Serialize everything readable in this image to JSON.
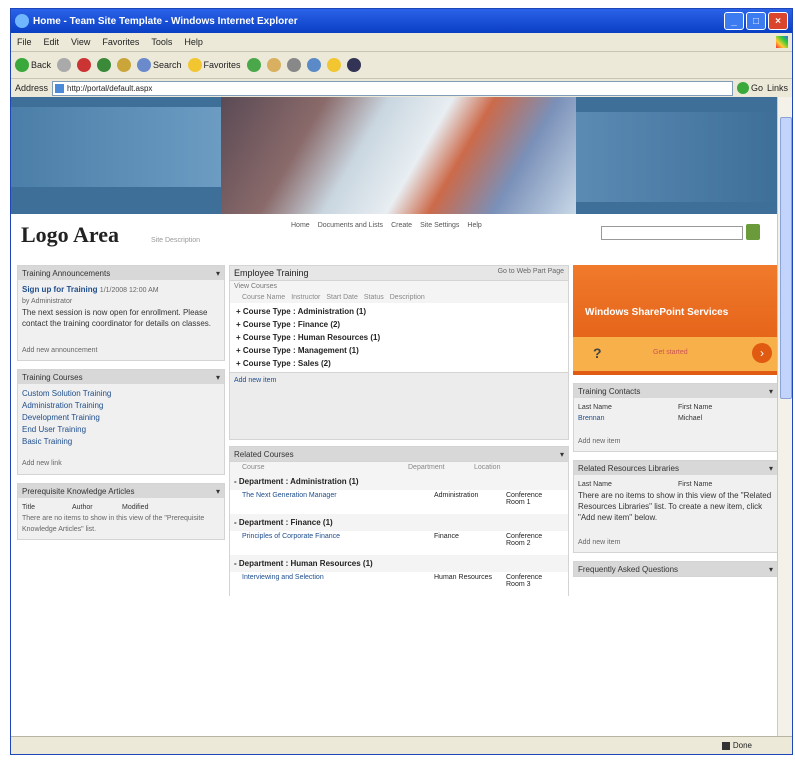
{
  "window": {
    "title": "Home - Team Site Template - Windows Internet Explorer",
    "buttons": [
      "_",
      "□",
      "×"
    ]
  },
  "menubar": [
    "File",
    "Edit",
    "View",
    "Favorites",
    "Tools",
    "Help"
  ],
  "toolbar": {
    "back_label": "Back",
    "search_label": "Search",
    "favorites_label": "Favorites"
  },
  "address": {
    "label": "Address",
    "url": "http://portal/default.aspx",
    "go_label": "Go",
    "links_label": "Links"
  },
  "site": {
    "logo": "Logo Area",
    "logo_sub": "Site Description",
    "topnav": [
      "Home",
      "Documents and Lists",
      "Create",
      "Site Settings",
      "Help"
    ]
  },
  "left": {
    "panel1": {
      "title": "Training Announcements",
      "heading": "Sign up for Training",
      "heading_suffix": "1/1/2008 12:00 AM",
      "by": "by Administrator",
      "body": "The next session is now open for enrollment. Please contact the training coordinator for details on classes.",
      "add": "Add new announcement"
    },
    "panel2": {
      "title": "Training Courses",
      "items": [
        "Custom Solution Training",
        "Administration Training",
        "Development Training",
        "End User Training",
        "Basic Training"
      ],
      "add": "Add new link"
    },
    "panel3": {
      "title": "Prerequisite Knowledge Articles",
      "cols": [
        "Title",
        "Author",
        "Modified"
      ],
      "body": "There are no items to show in this view of the \"Prerequisite Knowledge Articles\" list."
    }
  },
  "middle": {
    "header": "Employee Training",
    "header_right": "Go to Web Part Page",
    "subhead": "View Courses",
    "filters": [
      "Course Name",
      "Instructor",
      "Start Date",
      "Status",
      "Description"
    ],
    "groups": [
      "+ Course Type : Administration (1)",
      "+ Course Type : Finance (2)",
      "+ Course Type : Human Resources (1)",
      "+ Course Type : Management (1)",
      "+ Course Type : Sales (2)"
    ],
    "add": "Add new item",
    "courses": {
      "title": "Related Courses",
      "cols": [
        "Course",
        "Department",
        "Location"
      ],
      "groups": [
        {
          "label": "- Department : Administration (1)",
          "row": [
            "The Next Generation Manager",
            "Administration",
            "Conference Room 1"
          ]
        },
        {
          "label": "- Department : Finance (1)",
          "row": [
            "Principles of Corporate Finance",
            "Finance",
            "Conference Room 2"
          ]
        },
        {
          "label": "- Department : Human Resources (1)",
          "row": [
            "Interviewing and Selection",
            "Human Resources",
            "Conference Room 3"
          ]
        }
      ]
    }
  },
  "right": {
    "promo_title": "Windows SharePoint Services",
    "promo_symbol": "?",
    "promo_link": "Get started",
    "panel1": {
      "title": "Training Contacts",
      "cols": [
        "Last Name",
        "First Name"
      ],
      "rows": [
        [
          "Brennan",
          "Michael"
        ]
      ],
      "add": "Add new item"
    },
    "panel2": {
      "title": "Related Resources Libraries",
      "cols": [
        "Last Name",
        "First Name"
      ],
      "body": "There are no items to show in this view of the \"Related Resources Libraries\" list. To create a new item, click \"Add new item\" below.",
      "add": "Add new item"
    },
    "panel3": {
      "title": "Frequently Asked Questions"
    }
  },
  "status": {
    "zone": "Done"
  }
}
